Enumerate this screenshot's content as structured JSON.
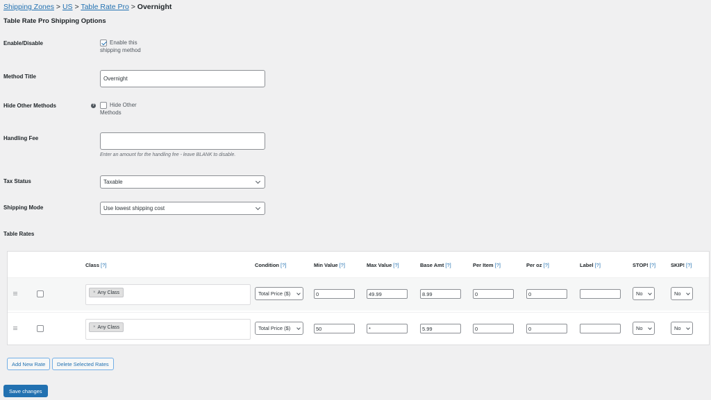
{
  "breadcrumb": {
    "items": [
      "Shipping Zones",
      "US",
      "Table Rate Pro"
    ],
    "separator": ">",
    "current": "Overnight"
  },
  "section_title": "Table Rate Pro Shipping Options",
  "settings": {
    "enable": {
      "label": "Enable/Disable",
      "checkbox_label": "Enable this shipping method",
      "checked": true
    },
    "method_title": {
      "label": "Method Title",
      "value": "Overnight"
    },
    "hide_other": {
      "label": "Hide Other Methods",
      "checkbox_label": "Hide Other Methods",
      "checked": false,
      "help_icon": "help-icon"
    },
    "handling_fee": {
      "label": "Handling Fee",
      "value": "",
      "description": "Enter an amount for the handling fee - leave BLANK to disable."
    },
    "tax_status": {
      "label": "Tax Status",
      "value": "Taxable"
    },
    "shipping_mode": {
      "label": "Shipping Mode",
      "value": "Use lowest shipping cost"
    },
    "table_rates_label": "Table Rates"
  },
  "table": {
    "help_marker": "[?]",
    "columns": [
      "Class",
      "Condition",
      "Min Value",
      "Max Value",
      "Base Amt",
      "Per Item",
      "Per oz",
      "Label",
      "STOP!",
      "SKIP!"
    ],
    "rows": [
      {
        "class_chip": "Any Class",
        "condition": "Total Price ($)",
        "min": "0",
        "max": "49.99",
        "base": "8.99",
        "per_item": "0",
        "per_oz": "0",
        "label": "",
        "stop": "No",
        "skip": "No"
      },
      {
        "class_chip": "Any Class",
        "condition": "Total Price ($)",
        "min": "50",
        "max": "*",
        "base": "5.99",
        "per_item": "0",
        "per_oz": "0",
        "label": "",
        "stop": "No",
        "skip": "No"
      }
    ],
    "chip_remove": "×"
  },
  "buttons": {
    "add_rate": "Add New Rate",
    "delete_rates": "Delete Selected Rates",
    "save": "Save changes"
  },
  "colors": {
    "accent": "#2271b1",
    "background": "#f0f0f1"
  }
}
